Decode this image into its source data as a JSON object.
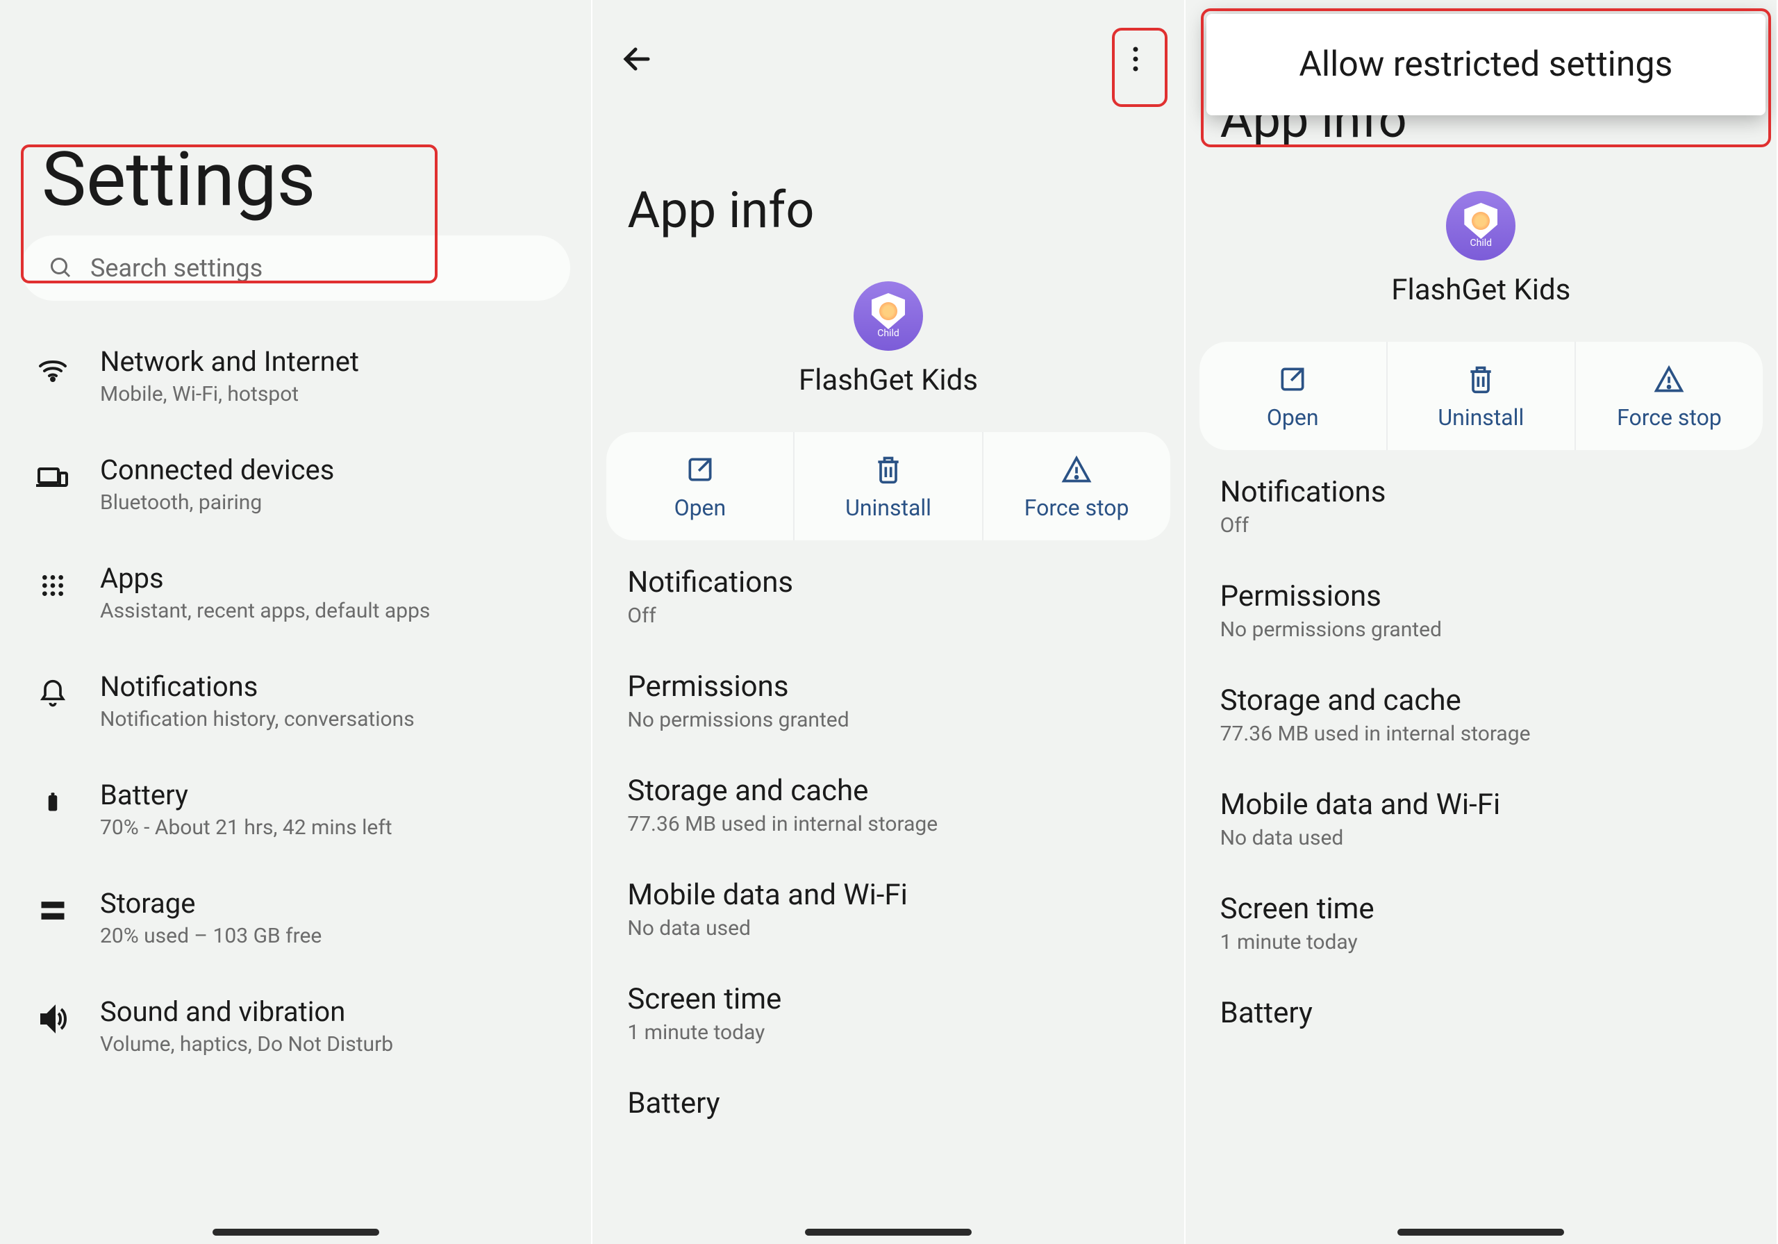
{
  "panel1": {
    "title": "Settings",
    "search_placeholder": "Search settings",
    "items": [
      {
        "title": "Network and Internet",
        "sub": "Mobile, Wi-Fi, hotspot"
      },
      {
        "title": "Connected devices",
        "sub": "Bluetooth, pairing"
      },
      {
        "title": "Apps",
        "sub": "Assistant, recent apps, default apps"
      },
      {
        "title": "Notifications",
        "sub": "Notification history, conversations"
      },
      {
        "title": "Battery",
        "sub": "70% - About 21 hrs, 42 mins left"
      },
      {
        "title": "Storage",
        "sub": "20% used – 103 GB free"
      },
      {
        "title": "Sound and vibration",
        "sub": "Volume, haptics, Do Not Disturb"
      }
    ]
  },
  "panel2": {
    "page_title": "App info",
    "app_name": "FlashGet Kids",
    "app_icon_label": "Child",
    "actions": {
      "open": "Open",
      "uninstall": "Uninstall",
      "forcestop": "Force stop"
    },
    "info": [
      {
        "title": "Notifications",
        "sub": "Off"
      },
      {
        "title": "Permissions",
        "sub": "No permissions granted"
      },
      {
        "title": "Storage and cache",
        "sub": "77.36 MB used in internal storage"
      },
      {
        "title": "Mobile data and Wi-Fi",
        "sub": "No data used"
      },
      {
        "title": "Screen time",
        "sub": "1 minute today"
      },
      {
        "title": "Battery",
        "sub": ""
      }
    ]
  },
  "panel3": {
    "page_title": "App info",
    "popup_item": "Allow restricted settings",
    "app_name": "FlashGet Kids",
    "app_icon_label": "Child",
    "actions": {
      "open": "Open",
      "uninstall": "Uninstall",
      "forcestop": "Force stop"
    },
    "info": [
      {
        "title": "Notifications",
        "sub": "Off"
      },
      {
        "title": "Permissions",
        "sub": "No permissions granted"
      },
      {
        "title": "Storage and cache",
        "sub": "77.36 MB used in internal storage"
      },
      {
        "title": "Mobile data and Wi-Fi",
        "sub": "No data used"
      },
      {
        "title": "Screen time",
        "sub": "1 minute today"
      },
      {
        "title": "Battery",
        "sub": ""
      }
    ]
  }
}
